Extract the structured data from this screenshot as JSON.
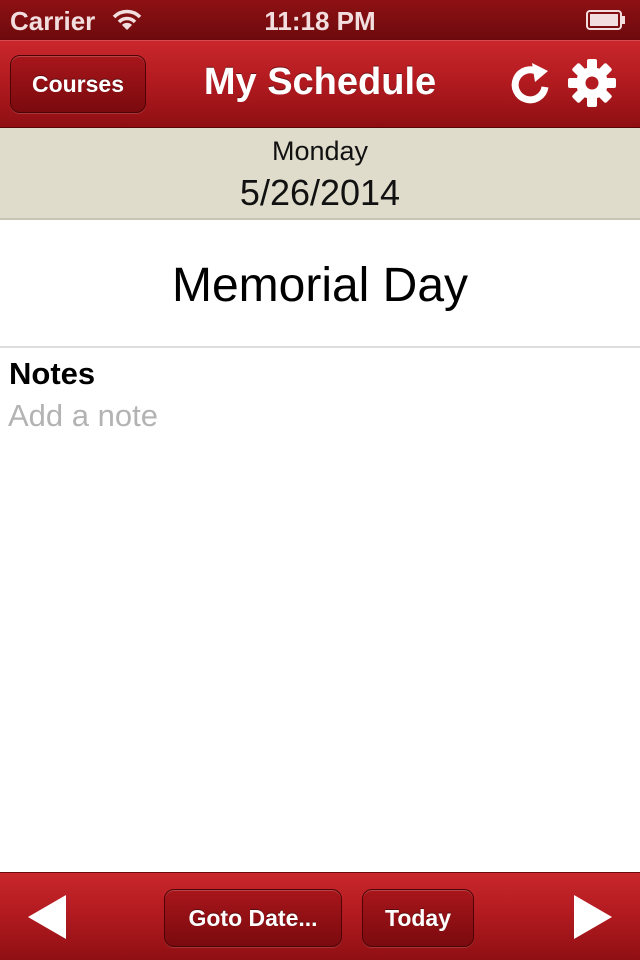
{
  "status_bar": {
    "carrier": "Carrier",
    "time": "11:18 PM"
  },
  "nav": {
    "title": "My Schedule",
    "courses_label": "Courses",
    "refresh_icon": "refresh-icon",
    "settings_icon": "gear-icon"
  },
  "date_header": {
    "weekday": "Monday",
    "date": "5/26/2014"
  },
  "event": {
    "name": "Memorial Day"
  },
  "notes": {
    "label": "Notes",
    "placeholder": "Add a note",
    "value": ""
  },
  "toolbar": {
    "goto_label": "Goto Date...",
    "today_label": "Today",
    "prev_icon": "previous-arrow-icon",
    "next_icon": "next-arrow-icon"
  },
  "colors": {
    "bar_red": "#b31b20",
    "date_band": "#e0dccb"
  }
}
